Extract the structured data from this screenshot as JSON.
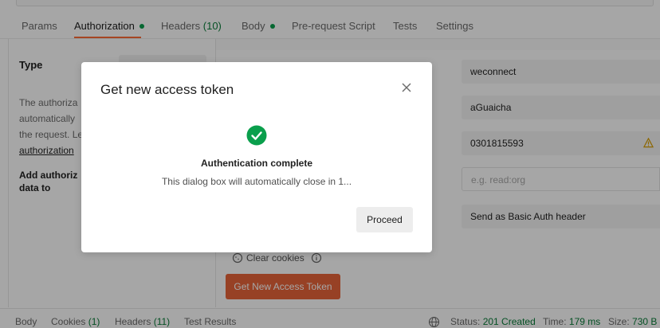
{
  "tabs": {
    "params": "Params",
    "authorization": "Authorization",
    "headers": "Headers",
    "headers_count": "(10)",
    "body": "Body",
    "prerequest": "Pre-request Script",
    "tests": "Tests",
    "settings": "Settings"
  },
  "left_panel": {
    "type_label": "Type",
    "desc_line1": "The authoriza",
    "desc_line2": "automatically",
    "desc_line3": "the request. Le",
    "desc_link": "authorization",
    "add_label_line1": "Add authoriz",
    "add_label_line2": "data to"
  },
  "fields": {
    "field1_value": "weconnect",
    "field2_value": "aGuaicha",
    "field3_value": "0301815593",
    "scope_placeholder": "e.g. read:org",
    "client_auth_value": "Send as Basic Auth header"
  },
  "actions": {
    "clear_cookies": "Clear cookies",
    "get_token": "Get New Access Token"
  },
  "status_bar": {
    "body": "Body",
    "cookies": "Cookies",
    "cookies_count": "(1)",
    "headers": "Headers",
    "headers_count": "(11)",
    "test_results": "Test Results",
    "status_label": "Status:",
    "status_value": "201 Created",
    "time_label": "Time:",
    "time_value": "179 ms",
    "size_label": "Size:",
    "size_value": "730 B"
  },
  "modal": {
    "title": "Get new access token",
    "heading": "Authentication complete",
    "message": "This dialog box will automatically close in 1...",
    "proceed": "Proceed"
  },
  "colors": {
    "accent": "#ff6c37",
    "primary_button": "#e8643a",
    "success": "#0a9f4c",
    "status_green": "#0a7d39"
  },
  "icons": [
    "close-icon",
    "check-circle-icon",
    "warning-icon",
    "cookie-icon",
    "info-icon",
    "globe-icon"
  ]
}
